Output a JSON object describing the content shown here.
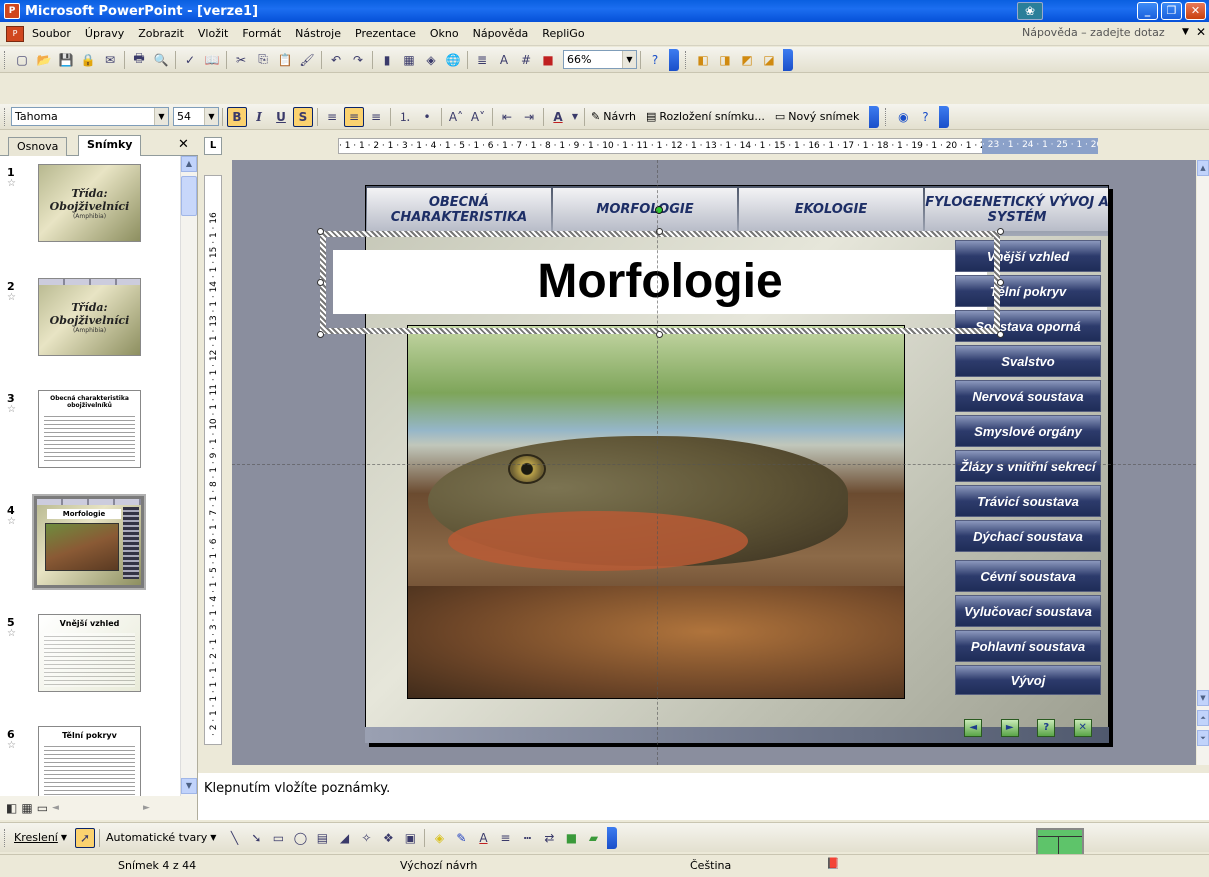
{
  "window": {
    "title": "Microsoft PowerPoint - [verze1]",
    "min_glyph": "_",
    "max_glyph": "❐",
    "close_glyph": "✕"
  },
  "menu": {
    "items": [
      "Soubor",
      "Úpravy",
      "Zobrazit",
      "Vložit",
      "Formát",
      "Nástroje",
      "Prezentace",
      "Okno",
      "Nápověda",
      "RepliGo"
    ],
    "help_placeholder": "Nápověda – zadejte dotaz"
  },
  "standard_toolbar": {
    "zoom": "66%"
  },
  "format_toolbar": {
    "font": "Tahoma",
    "size": "54",
    "bold": "B",
    "italic": "I",
    "underline": "U",
    "shadow": "S",
    "design_label": "Návrh",
    "layout_label": "Rozložení snímku...",
    "new_slide_label": "Nový snímek"
  },
  "left_panel": {
    "tab_outline": "Osnova",
    "tab_slides": "Snímky",
    "slides": [
      {
        "num": "1",
        "title": "Třída: Obojživelníci",
        "sub": "(Amphibia)"
      },
      {
        "num": "2",
        "title": "Třída: Obojživelníci",
        "sub": "(Amphibia)"
      },
      {
        "num": "3",
        "title": "Obecná charakteristika obojživelníků"
      },
      {
        "num": "4",
        "title": "Morfologie"
      },
      {
        "num": "5",
        "title": "Vnější vzhled"
      },
      {
        "num": "6",
        "title": "Tělní pokryv"
      }
    ]
  },
  "ruler": {
    "h_scale": "· 1 · 1 · 2 · 1 · 3 · 1 · 4 · 1 · 5 · 1 · 6 · 1 · 7 · 1 · 8 · 1 · 9 · 1 · 10 · 1 · 11 · 1 · 12 · 1 · 13 · 1 · 14 · 1 · 15 · 1 · 16 · 1 · 17 · 1 · 18 · 1 · 19 · 1 · 20 · 1 · 21 · 1 · 22",
    "h_scale_grey": "· 23 · 1 · 24 · 1 · 25 · 1 · 26",
    "v_scale": "· 2 · 1 · 1 · 1 · 1 · 2 · 1 · 3 · 1 · 4 · 1 · 5 · 1 · 6 · 1 · 7 · 1 · 8 · 1 · 9 · 1 · 10 · 1 · 11 · 1 · 12 · 1 · 13 · 1 · 14 · 1 · 15 · 1 · 16"
  },
  "slide": {
    "nav_tabs": [
      "OBECNÁ CHARAKTERISTIKA",
      "MORFOLOGIE",
      "EKOLOGIE",
      "FYLOGENETICKÝ VÝVOJ A SYSTÉM"
    ],
    "title": "Morfologie",
    "side_menu": [
      "Vnější vzhled",
      "Tělní pokryv",
      "Soustava oporná",
      "Svalstvo",
      "Nervová soustava",
      "Smyslové orgány",
      "Žlázy s vnitřní sekrecí",
      "Trávicí soustava",
      "Dýchací soustava",
      "Cévní soustava",
      "Vylučovací soustava",
      "Pohlavní soustava",
      "Vývoj"
    ],
    "controls": [
      "◄",
      "►",
      "?",
      "✕"
    ]
  },
  "notes": {
    "placeholder": "Klepnutím vložíte poznámky."
  },
  "drawing_toolbar": {
    "draw_label": "Kreslení",
    "autoshapes_label": "Automatické tvary"
  },
  "status": {
    "slide_info": "Snímek 4 z 44",
    "design": "Výchozí návrh",
    "language": "Čeština"
  },
  "colors": {
    "titlebar": "#0a5fe0",
    "nav_text": "#1d2e66",
    "side_menu_bg": "#2d3b6c"
  }
}
